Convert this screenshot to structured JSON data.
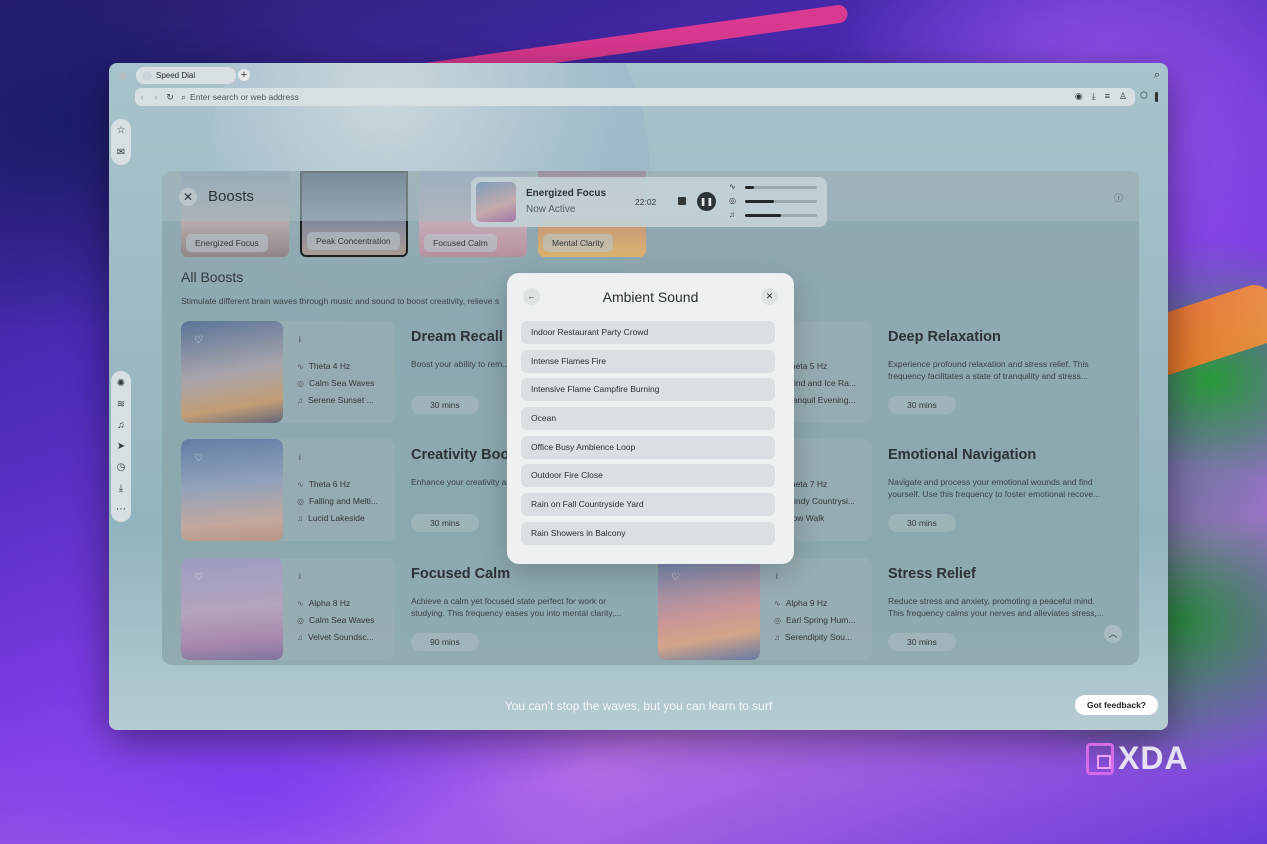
{
  "browser": {
    "tab_title": "Speed Dial",
    "address_placeholder": "Enter search or web address"
  },
  "panel": {
    "title": "Boosts",
    "featured": [
      "Energized Focus",
      "Peak Concentration",
      "Focused Calm",
      "Mental Clarity"
    ],
    "section_title": "All Boosts",
    "section_subtitle": "Stimulate different brain waves through music and sound to boost creativity, relieve s"
  },
  "cards": [
    {
      "freq": "Theta 4 Hz",
      "sound": "Calm Sea Waves",
      "music": "Serene Sunset ...",
      "title": "Dream Recall",
      "desc": "Boost your ability to rem... tap into recalling of drea...",
      "duration": "30 mins"
    },
    {
      "freq": "Theta 5 Hz",
      "sound": "Wind and Ice Ra...",
      "music": "Tranquil Evening...",
      "title": "Deep Relaxation",
      "desc": "Experience profound relaxation and stress relief. This frequency facilitates a state of tranquility and stress...",
      "duration": "30 mins"
    },
    {
      "freq": "Theta 6 Hz",
      "sound": "Falling and Melti...",
      "music": "Lucid Lakeside",
      "title": "Creativity Boos",
      "desc": "Enhance your creativity a... frequency stimulates you...",
      "duration": "30 mins"
    },
    {
      "freq": "Theta 7 Hz",
      "sound": "Windy Countrysi...",
      "music": "Slow Walk",
      "title": "Emotional Navigation",
      "desc": "Navigate and process your emotional wounds and find yourself. Use this frequency to foster emotional recove...",
      "duration": "30 mins"
    },
    {
      "freq": "Alpha 8 Hz",
      "sound": "Calm Sea Waves",
      "music": "Velvet Soundsc...",
      "title": "Focused Calm",
      "desc": "Achieve a calm yet focused state perfect for work or studying. This frequency eases you into mental clarity,...",
      "duration": "90 mins"
    },
    {
      "freq": "Alpha 9 Hz",
      "sound": "Earl Spring Hum...",
      "music": "Serendipity Sou...",
      "title": "Stress Relief",
      "desc": "Reduce stress and anxiety, promoting a peaceful mind. This frequency calms your nerves and alleviates stress,...",
      "duration": "30 mins"
    }
  ],
  "player": {
    "title": "Energized Focus",
    "status": "Now Active",
    "time": "22:02",
    "levels": [
      0.12,
      0.4,
      0.5
    ]
  },
  "modal": {
    "title": "Ambient Sound",
    "items": [
      "Indoor Restaurant Party Crowd",
      "Intense Flames Fire",
      "Intensive Flame Campfire Burning",
      "Ocean",
      "Office Busy Ambience Loop",
      "Outdoor Fire Close",
      "Rain on Fall Countryside Yard",
      "Rain Showers in Balcony"
    ]
  },
  "footer": {
    "quote": "You can't stop the waves, but you can learn to surf",
    "feedback": "Got feedback?"
  },
  "watermark": "XDA"
}
